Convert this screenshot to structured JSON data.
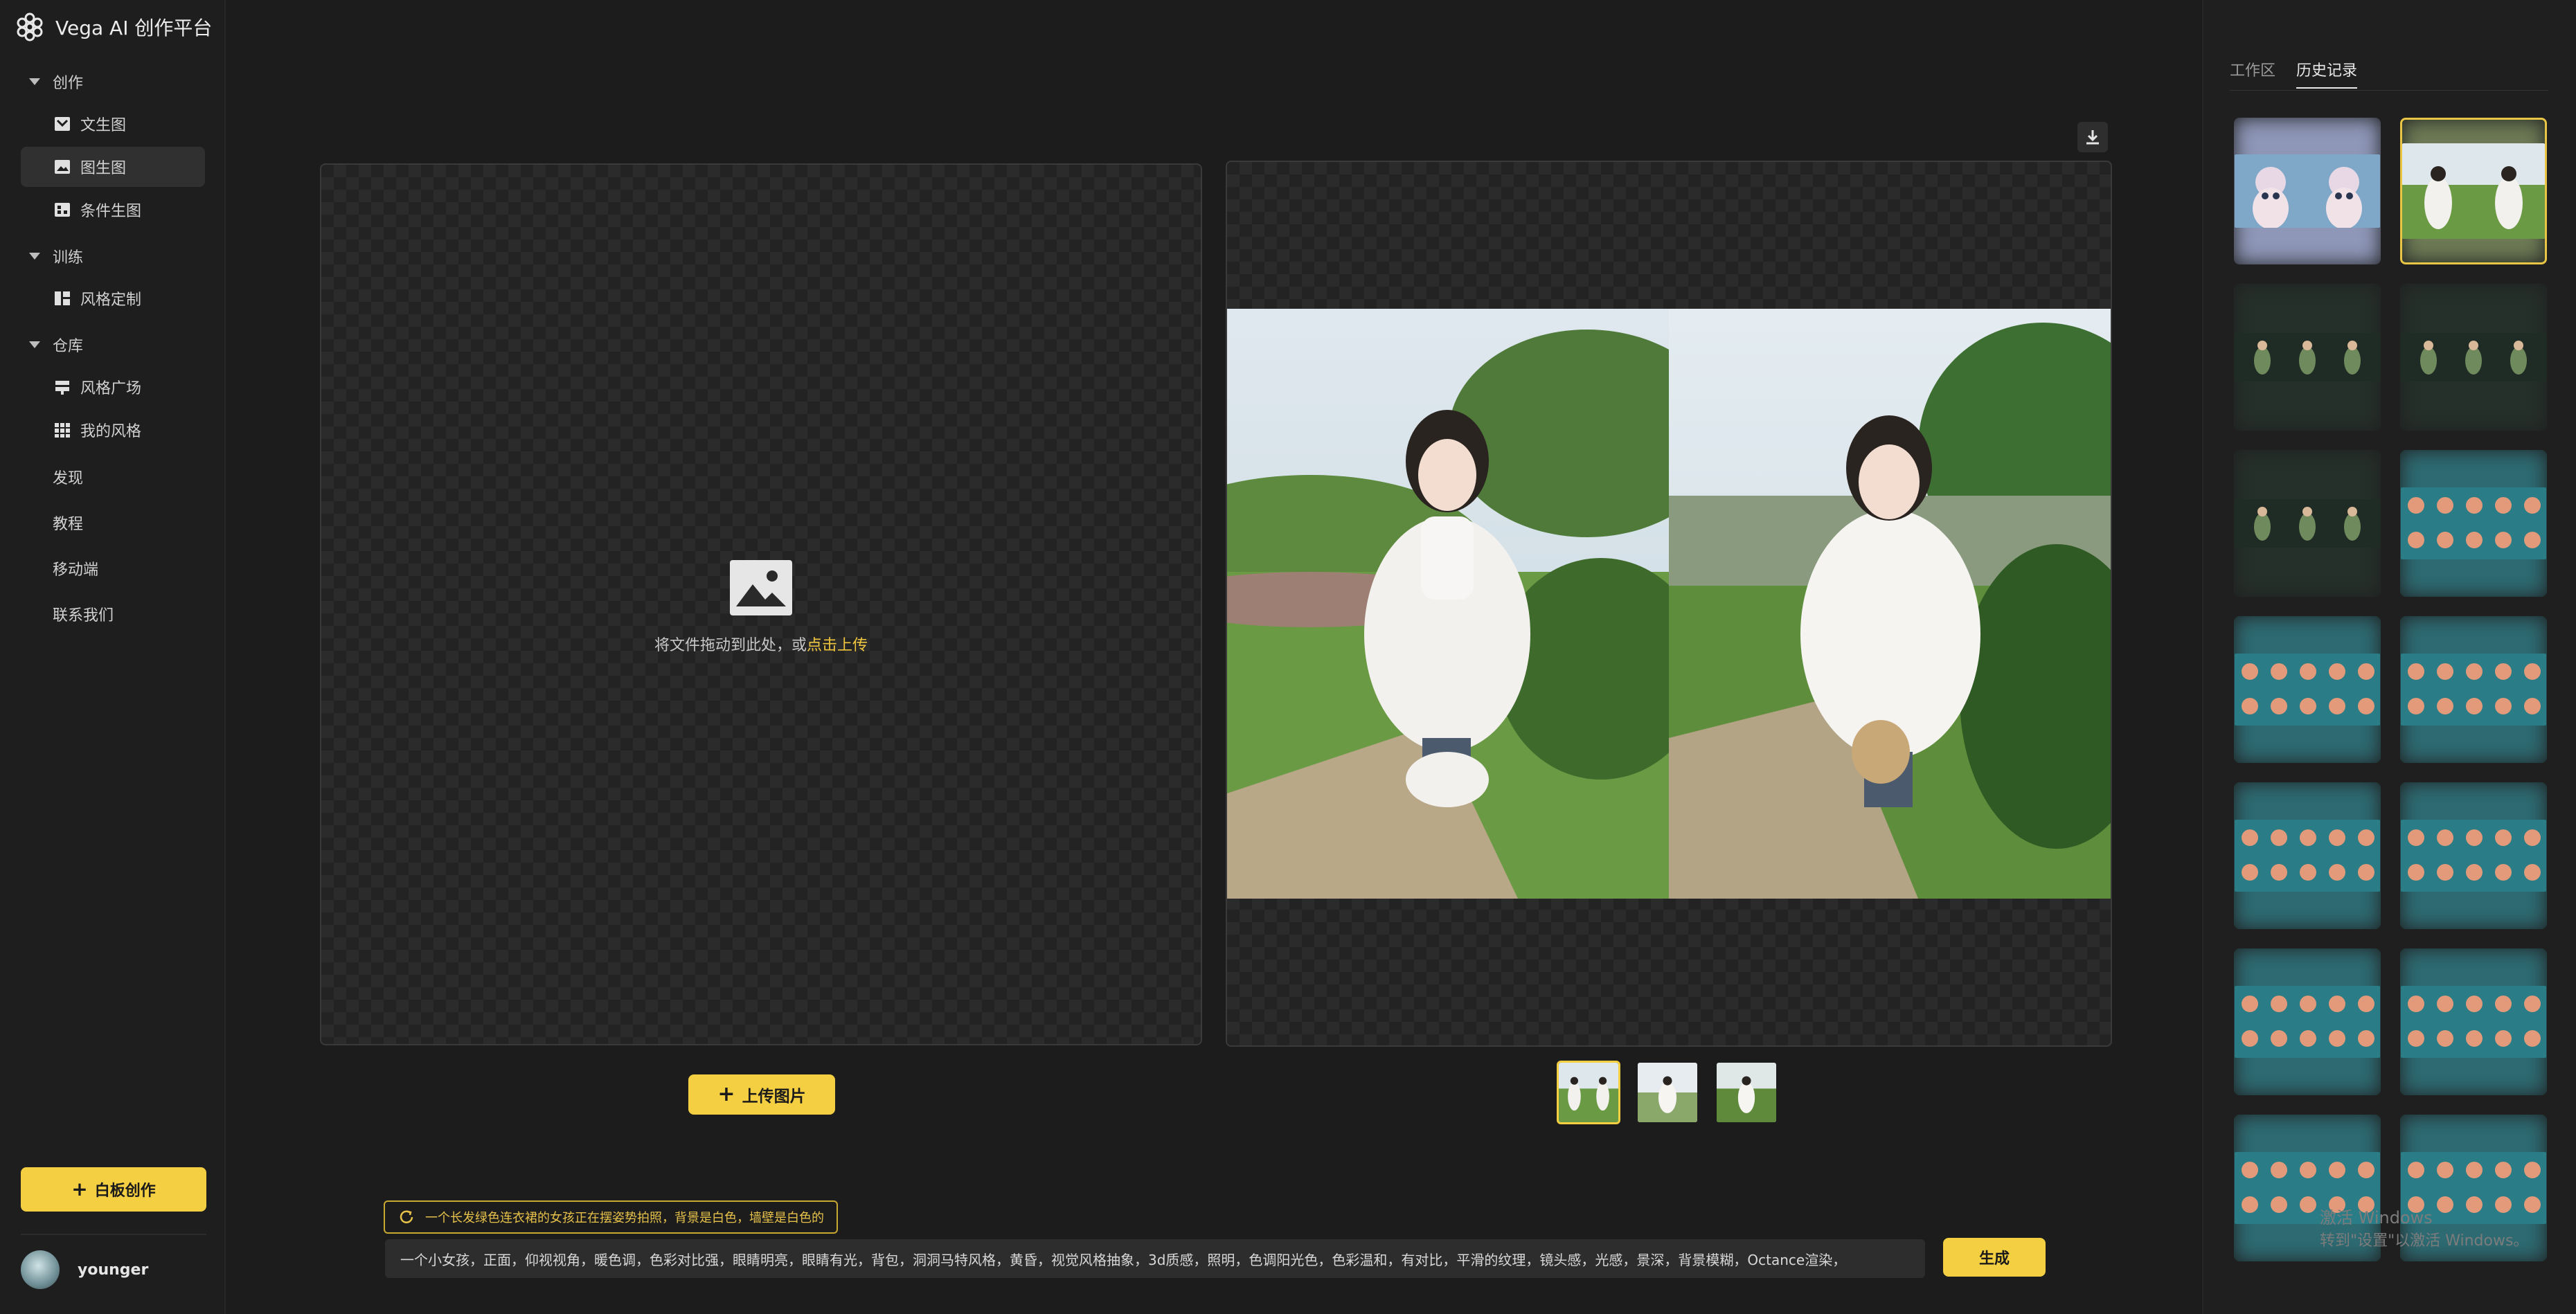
{
  "app": {
    "title": "Vega AI 创作平台"
  },
  "sidebar": {
    "sections": [
      {
        "label": "创作",
        "items": [
          {
            "label": "文生图"
          },
          {
            "label": "图生图",
            "active": true
          },
          {
            "label": "条件生图"
          }
        ]
      },
      {
        "label": "训练",
        "items": [
          {
            "label": "风格定制"
          }
        ]
      },
      {
        "label": "仓库",
        "items": [
          {
            "label": "风格广场"
          },
          {
            "label": "我的风格"
          }
        ]
      }
    ],
    "links": [
      "发现",
      "教程",
      "移动端",
      "联系我们"
    ],
    "whiteboard_button": "白板创作",
    "user": {
      "name": "younger"
    }
  },
  "header": {
    "icons": [
      "settings-hex-icon",
      "bell-icon",
      "headset-icon"
    ]
  },
  "canvas": {
    "upload_hint_prefix": "将文件拖动到此处，或",
    "upload_hint_link": "点击上传",
    "upload_button": "上传图片",
    "accent": "#f5cf42"
  },
  "suggestion": {
    "text": "一个长发绿色连衣裙的女孩正在摆姿势拍照，背景是白色，墙壁是白色的"
  },
  "prompt": {
    "text": "一个小女孩，正面，仰视视角，暖色调，色彩对比强，眼睛明亮，眼睛有光，背包，洞洞马特风格，黄昏，视觉风格抽象，3d质感，照明，色调阳光色，色彩温和，有对比，平滑的纹理，镜头感，光感，景深，背景模糊，Octance渲染，"
  },
  "generate_button": "生成",
  "right_panel": {
    "tabs": [
      {
        "label": "工作区",
        "active": false
      },
      {
        "label": "历史记录",
        "active": true
      }
    ]
  },
  "watermark": {
    "line1": "激活 Windows",
    "line2": "转到\"设置\"以激活 Windows。"
  }
}
